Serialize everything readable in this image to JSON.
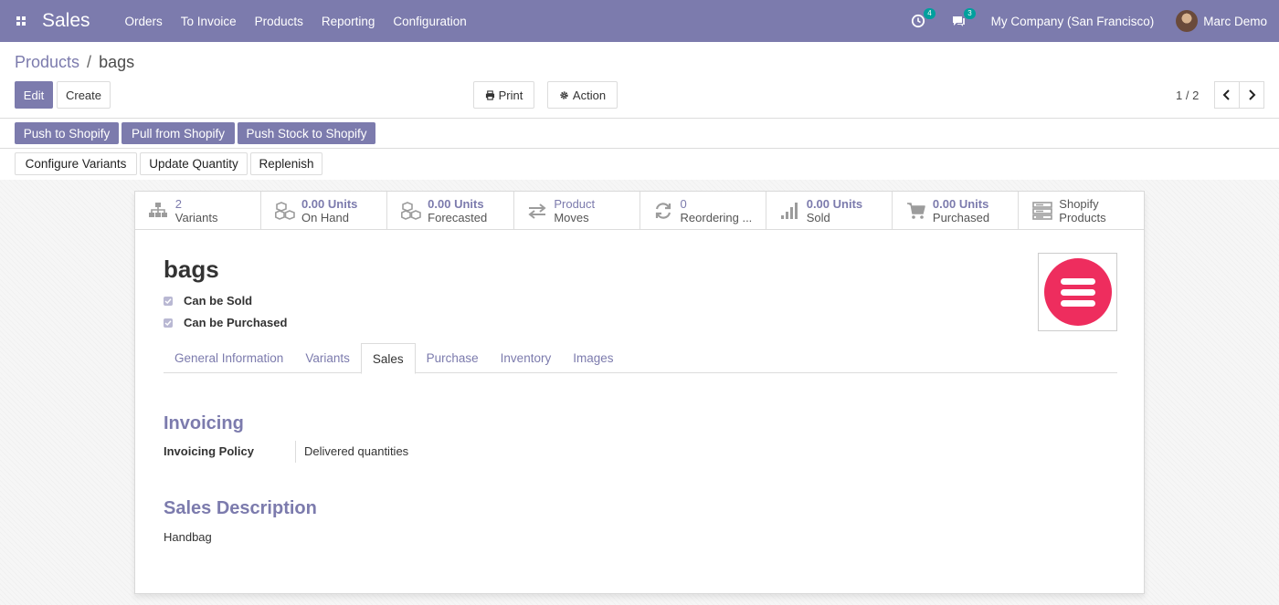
{
  "navbar": {
    "app_name": "Sales",
    "menu": [
      "Orders",
      "To Invoice",
      "Products",
      "Reporting",
      "Configuration"
    ],
    "activity_badge": "4",
    "messages_badge": "3",
    "company": "My Company (San Francisco)",
    "user": "Marc Demo"
  },
  "breadcrumb": {
    "parent": "Products",
    "separator": "/",
    "current": "bags"
  },
  "buttons": {
    "edit": "Edit",
    "create": "Create",
    "print": "Print",
    "action": "Action"
  },
  "pager": {
    "value": "1 / 2"
  },
  "shopify_buttons": [
    "Push to Shopify",
    "Pull from Shopify",
    "Push Stock to Shopify"
  ],
  "status_buttons": [
    "Configure Variants",
    "Update Quantity",
    "Replenish"
  ],
  "stat_buttons": [
    {
      "icon": "sitemap-icon",
      "value": "2",
      "label": "Variants"
    },
    {
      "icon": "cubes-icon",
      "value": "0.00 Units",
      "label": "On Hand"
    },
    {
      "icon": "cubes-icon",
      "value": "0.00 Units",
      "label": "Forecasted"
    },
    {
      "icon": "exchange-icon",
      "value": "Product",
      "label": "Moves"
    },
    {
      "icon": "refresh-icon",
      "value": "0",
      "label": "Reordering ..."
    },
    {
      "icon": "signal-icon",
      "value": "0.00 Units",
      "label": "Sold"
    },
    {
      "icon": "shopping-cart-icon",
      "value": "0.00 Units",
      "label": "Purchased"
    },
    {
      "icon": "server-icon",
      "value": "Shopify",
      "label": "Products"
    }
  ],
  "product": {
    "name": "bags",
    "can_be_sold": "Can be Sold",
    "can_be_purchased": "Can be Purchased"
  },
  "tabs": {
    "items": [
      "General Information",
      "Variants",
      "Sales",
      "Purchase",
      "Inventory",
      "Images"
    ],
    "active": "Sales"
  },
  "invoicing": {
    "title": "Invoicing",
    "policy_label": "Invoicing Policy",
    "policy_value": "Delivered quantities"
  },
  "sales_description": {
    "title": "Sales Description",
    "text": "Handbag"
  },
  "colors": {
    "brand": "#7c7bad",
    "badge": "#00a09d",
    "image_accent": "#ee2d5e"
  }
}
